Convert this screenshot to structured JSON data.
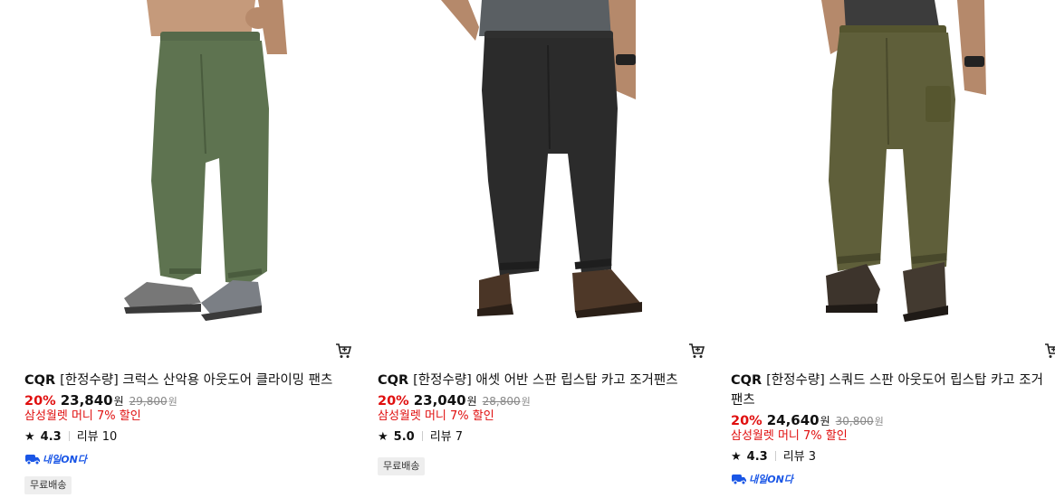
{
  "products": [
    {
      "image_alt": "green jogger pants",
      "pants_color": "#5e7350",
      "brand": "CQR",
      "title": "[한정수량] 크럭스 산악용 아웃도어 클라이밍 팬츠",
      "discount": "20%",
      "price": "23,840",
      "currency": "원",
      "original_price": "29,800",
      "promo": "삼성월렛 머니 7% 할인",
      "rating": "4.3",
      "review_label": "리뷰 10",
      "delivery_badge": "내일ON다",
      "free_shipping": "무료배송"
    },
    {
      "image_alt": "black jogger pants",
      "pants_color": "#2b2b2b",
      "brand": "CQR",
      "title": "[한정수량] 애셋 어반 스판 립스탑 카고 조거팬츠",
      "discount": "20%",
      "price": "23,040",
      "currency": "원",
      "original_price": "28,800",
      "promo": "삼성월렛 머니 7% 할인",
      "rating": "5.0",
      "review_label": "리뷰 7",
      "free_shipping": "무료배송"
    },
    {
      "image_alt": "olive cargo jogger pants",
      "pants_color": "#5f5f3a",
      "brand": "CQR",
      "title": "[한정수량] 스쿼드 스판 아웃도어 립스탑 카고 조거 팬츠",
      "discount": "20%",
      "price": "24,640",
      "currency": "원",
      "original_price": "30,800",
      "promo": "삼성월렛 머니 7% 할인",
      "rating": "4.3",
      "review_label": "리뷰 3",
      "delivery_badge": "내일ON다"
    }
  ]
}
